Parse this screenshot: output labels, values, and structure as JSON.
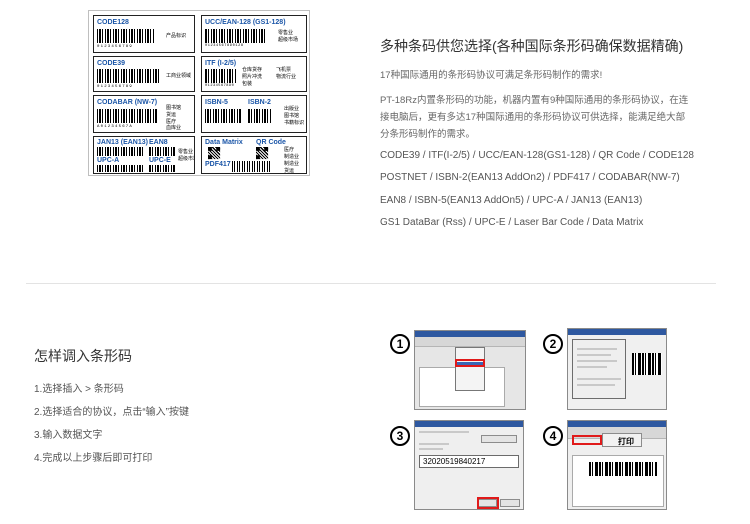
{
  "samples": [
    {
      "title": "CODE128",
      "zh": "产品标识",
      "digits": "0123456789"
    },
    {
      "title": "UCC/EAN-128 (GS1-128)",
      "zh": "零售业\n超级市场",
      "digits": "01234567890128"
    },
    {
      "title": "CODE39",
      "zh": "工商业领域",
      "digits": "0123456789"
    },
    {
      "title": "ITF (I-2/5)",
      "zh": "仓库货存\n照片冲洗\n包装",
      "zh2": "飞机票\n物流行业",
      "digits": "01234567890"
    },
    {
      "title": "CODABAR (NW-7)",
      "zh": "图书馆\n货运\n医疗\n血库业",
      "digits": "A01234567A"
    },
    {
      "title": "ISBN-5",
      "title2": "ISBN-2",
      "zh": "出版业\n图书馆\n书籍标识"
    },
    {
      "title": "JAN13 (EAN13)",
      "title2": "EAN8",
      "digits": "0123456789012",
      "digits2": "01234565"
    },
    {
      "title": "UPC-A",
      "title2": "UPC-E",
      "zh": "零售业\n超级市场",
      "digits": "012345678905",
      "digits2": "01234565"
    },
    {
      "title": "Data Matrix",
      "title2": "QR Code",
      "zh": "医疗\n制造业"
    },
    {
      "title": "PDF417",
      "zh": "制造业\n货运"
    }
  ],
  "info": {
    "title": "多种条码供您选择(各种国际条形码确保数据精确)",
    "lead": "17种国际通用的条形码协议可满足条形码制作的需求!",
    "desc_lines": [
      "PT-18Rz内置条形码的功能，机器内置有9种国际通用的条形码协议，在连",
      "接电脑后，更有多达17种国际通用的条形码协议可供选择，能满足绝大部",
      "分条形码制作的需求。"
    ],
    "barcode_lists": [
      "CODE39 / ITF(I-2/5) / UCC/EAN-128(GS1-128) / QR Code / CODE128",
      "POSTNET / ISBN-2(EAN13 AddOn2) / PDF417 / CODABAR(NW-7)",
      "EAN8 / ISBN-5(EAN13 AddOn5) / UPC-A / JAN13 (EAN13)",
      "GS1 DataBar (Rss) / UPC-E / Laser Bar Code / Data Matrix"
    ]
  },
  "howto": {
    "title": "怎样调入条形码",
    "steps": [
      "1.选择插入 > 条形码",
      "2.选择适合的协议，点击“输入”按键",
      "3.输入数据文字",
      "4.完成以上步骤后即可打印"
    ],
    "step_numbers": [
      "1",
      "2",
      "3",
      "4"
    ],
    "input_value": "32020519840217",
    "print_label": "打印"
  }
}
